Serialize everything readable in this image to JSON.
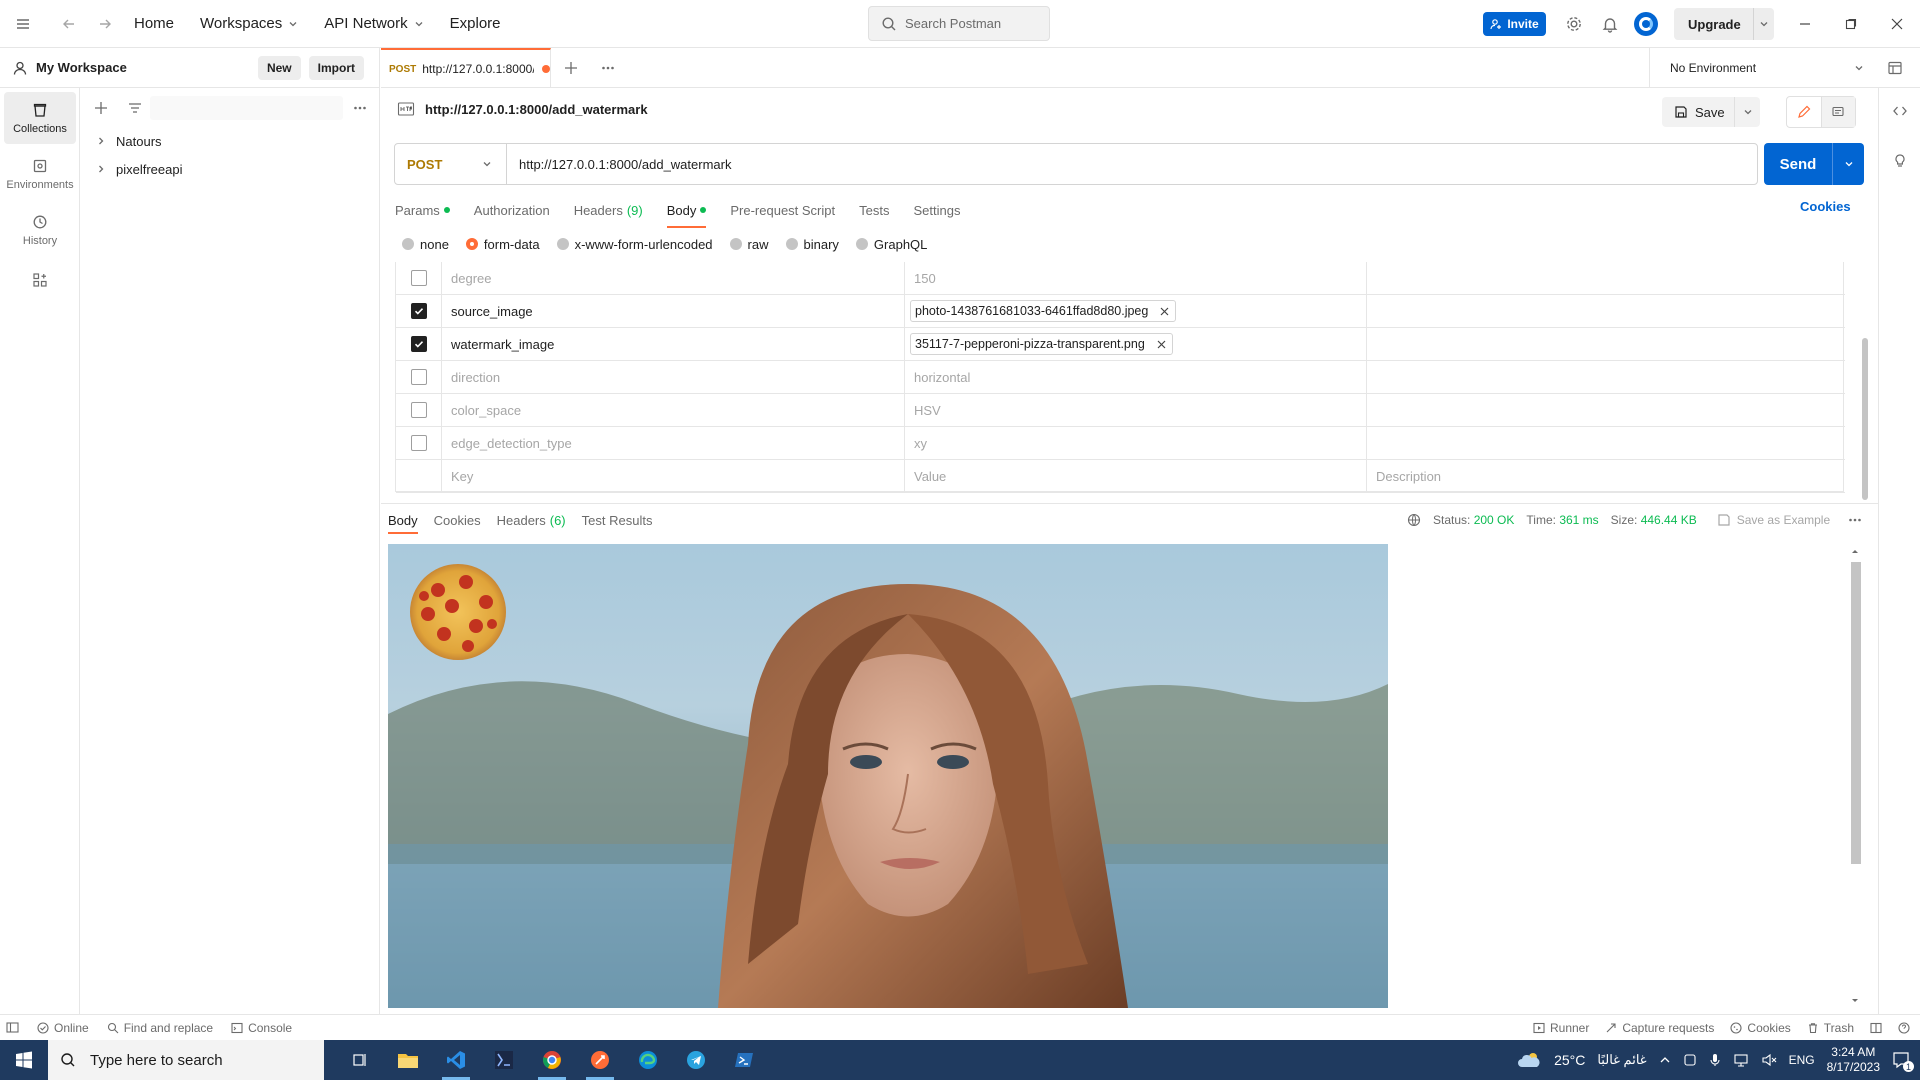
{
  "topbar": {
    "nav": [
      "Home",
      "Workspaces",
      "API Network",
      "Explore"
    ],
    "search_placeholder": "Search Postman",
    "invite_label": "Invite",
    "upgrade_label": "Upgrade"
  },
  "sidebar": {
    "workspace_title": "My Workspace",
    "new_label": "New",
    "import_label": "Import",
    "rail": [
      {
        "label": "Collections",
        "icon": "collections-icon"
      },
      {
        "label": "Environments",
        "icon": "environments-icon"
      },
      {
        "label": "History",
        "icon": "history-icon"
      }
    ],
    "collections": [
      "Natours",
      "pixelfreeapi"
    ]
  },
  "tab": {
    "method": "POST",
    "title": "http://127.0.0.1:8000/a"
  },
  "environment": "No Environment",
  "request": {
    "name": "http://127.0.0.1:8000/add_watermark",
    "save_label": "Save",
    "method": "POST",
    "url": "http://127.0.0.1:8000/add_watermark",
    "send_label": "Send",
    "cookies_label": "Cookies",
    "tabs": [
      {
        "label": "Params",
        "dot": true
      },
      {
        "label": "Authorization"
      },
      {
        "label": "Headers",
        "count": "(9)"
      },
      {
        "label": "Body",
        "dot": true,
        "active": true
      },
      {
        "label": "Pre-request Script"
      },
      {
        "label": "Tests"
      },
      {
        "label": "Settings"
      }
    ],
    "body_types": [
      "none",
      "form-data",
      "x-www-form-urlencoded",
      "raw",
      "binary",
      "GraphQL"
    ],
    "body_type_selected": "form-data",
    "form_rows": [
      {
        "checked": false,
        "key": "degree",
        "value": "150",
        "file": false
      },
      {
        "checked": true,
        "key": "source_image",
        "value": "photo-1438761681033-6461ffad8d80.jpeg",
        "file": true
      },
      {
        "checked": true,
        "key": "watermark_image",
        "value": "35117-7-pepperoni-pizza-transparent.png",
        "file": true
      },
      {
        "checked": false,
        "key": "direction",
        "value": "horizontal",
        "file": false
      },
      {
        "checked": false,
        "key": "color_space",
        "value": "HSV",
        "file": false
      },
      {
        "checked": false,
        "key": "edge_detection_type",
        "value": "xy",
        "file": false
      }
    ],
    "placeholder_row": {
      "key": "Key",
      "value": "Value",
      "description": "Description"
    }
  },
  "response": {
    "tabs": [
      {
        "label": "Body",
        "active": true
      },
      {
        "label": "Cookies"
      },
      {
        "label": "Headers",
        "count": "(6)"
      },
      {
        "label": "Test Results"
      }
    ],
    "status_label": "Status:",
    "status_value": "200 OK",
    "time_label": "Time:",
    "time_value": "361 ms",
    "size_label": "Size:",
    "size_value": "446.44 KB",
    "save_example_label": "Save as Example"
  },
  "statusbar": {
    "online": "Online",
    "find_replace": "Find and replace",
    "console": "Console",
    "runner": "Runner",
    "capture": "Capture requests",
    "cookies": "Cookies",
    "trash": "Trash"
  },
  "taskbar": {
    "search_placeholder": "Type here to search",
    "weather": "25°C",
    "weather_text": "غائم غالبًا",
    "lang": "ENG",
    "time": "3:24 AM",
    "date": "8/17/2023",
    "notifications": "1"
  },
  "colors": {
    "accent": "#ff6c37",
    "primary": "#0265d2",
    "success": "#0cbb52",
    "post": "#ad7a03"
  }
}
